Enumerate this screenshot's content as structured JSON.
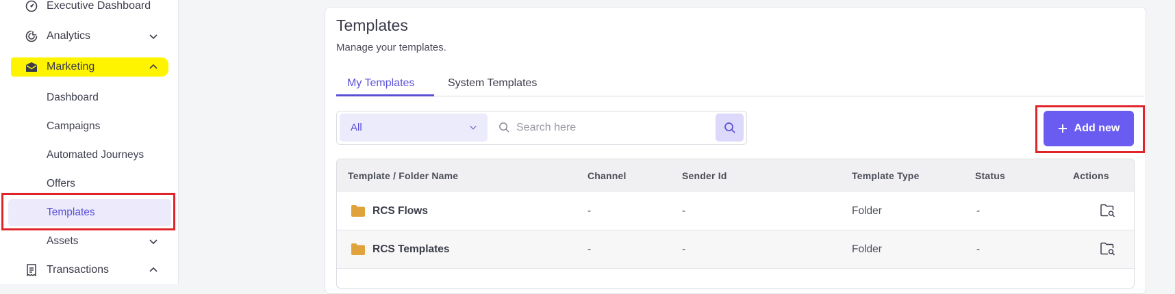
{
  "sidebar": {
    "items": [
      {
        "label": "Executive Dashboard",
        "icon": "gauge-icon"
      },
      {
        "label": "Analytics",
        "icon": "analytics-icon"
      },
      {
        "label": "Marketing",
        "icon": "mail-icon"
      },
      {
        "label": "Transactions",
        "icon": "receipt-icon"
      }
    ],
    "marketing_sub": [
      "Dashboard",
      "Campaigns",
      "Automated Journeys",
      "Offers",
      "Templates",
      "Assets"
    ],
    "active_sub": "Templates"
  },
  "page": {
    "title": "Templates",
    "subtitle": "Manage your templates.",
    "tabs": [
      "My Templates",
      "System Templates"
    ],
    "active_tab": "My Templates"
  },
  "filter": {
    "selected": "All",
    "search_placeholder": "Search here"
  },
  "add_button": {
    "label": "Add new"
  },
  "table": {
    "columns": [
      "Template / Folder Name",
      "Channel",
      "Sender Id",
      "Template Type",
      "Status",
      "Actions"
    ],
    "rows": [
      {
        "name": "RCS Flows",
        "channel": "-",
        "sender_id": "-",
        "type": "Folder",
        "status": "-"
      },
      {
        "name": "RCS Templates",
        "channel": "-",
        "sender_id": "-",
        "type": "Folder",
        "status": "-"
      }
    ]
  },
  "colors": {
    "accent": "#6a5cf0",
    "highlight": "#fff400",
    "annotation_red": "#e0242a",
    "folder": "#e0a23a"
  }
}
